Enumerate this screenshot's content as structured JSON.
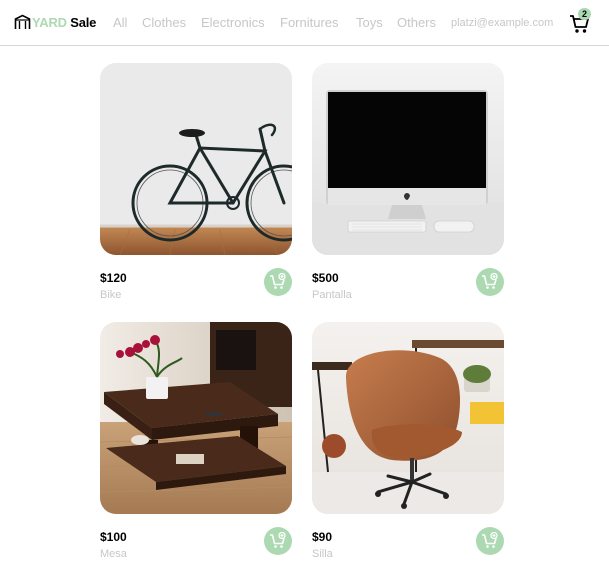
{
  "brand": {
    "part1": "YARD",
    "part2": "Sale",
    "logo_icon": "gate-icon"
  },
  "nav": {
    "categories": [
      "All",
      "Clothes",
      "Electronics",
      "Fornitures",
      "Toys",
      "Others"
    ],
    "email": "platzi@example.com",
    "cart": {
      "icon": "shopping-cart-icon",
      "count": "2"
    }
  },
  "products": [
    {
      "price": "$120",
      "name": "Bike"
    },
    {
      "price": "$500",
      "name": "Pantalla"
    },
    {
      "price": "$100",
      "name": "Mesa"
    },
    {
      "price": "$90",
      "name": "Silla"
    }
  ],
  "colors": {
    "accent": "#acd9b2",
    "muted_text": "#c7c7c7",
    "divider": "#d6d6d6"
  },
  "icons": {
    "add_to_cart": "add-to-cart-icon"
  }
}
